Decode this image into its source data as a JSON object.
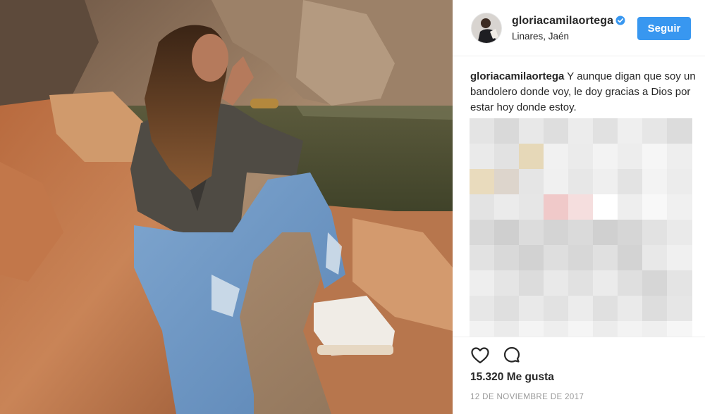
{
  "post": {
    "username": "gloriacamilaortega",
    "location": "Linares, Jaén",
    "follow_label": "Seguir",
    "caption_user": "gloriacamilaortega",
    "caption_text": " Y aunque digan que soy un bandolero donde voy, le doy gracias a Dios por estar hoy donde estoy.",
    "likes": "15.320 Me gusta",
    "date": "12 DE NOVIEMBRE DE 2017"
  },
  "icons": {
    "verified": "verified-badge-icon",
    "like": "heart-outline-icon",
    "comment": "comment-bubble-icon"
  },
  "colors": {
    "accent": "#3897f0",
    "text": "#262626",
    "muted": "#999999"
  }
}
